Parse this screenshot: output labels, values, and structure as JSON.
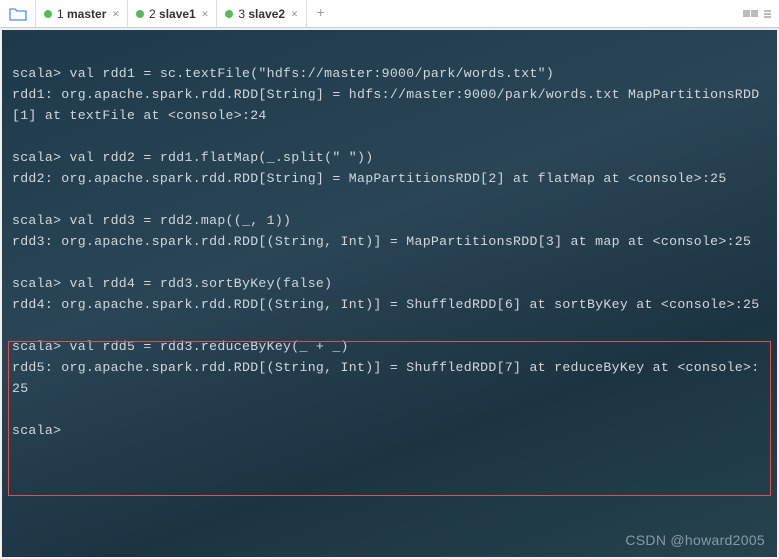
{
  "tabs": [
    {
      "label_prefix": "1 ",
      "label_bold": "master"
    },
    {
      "label_prefix": "2 ",
      "label_bold": "slave1"
    },
    {
      "label_prefix": "3 ",
      "label_bold": "slave2"
    }
  ],
  "console": {
    "lines": [
      "",
      "scala> val rdd1 = sc.textFile(\"hdfs://master:9000/park/words.txt\")",
      "rdd1: org.apache.spark.rdd.RDD[String] = hdfs://master:9000/park/words.txt MapPartitionsRDD[1] at textFile at <console>:24",
      "",
      "scala> val rdd2 = rdd1.flatMap(_.split(\" \"))",
      "rdd2: org.apache.spark.rdd.RDD[String] = MapPartitionsRDD[2] at flatMap at <console>:25",
      "",
      "scala> val rdd3 = rdd2.map((_, 1))",
      "rdd3: org.apache.spark.rdd.RDD[(String, Int)] = MapPartitionsRDD[3] at map at <console>:25",
      "",
      "scala> val rdd4 = rdd3.sortByKey(false)",
      "rdd4: org.apache.spark.rdd.RDD[(String, Int)] = ShuffledRDD[6] at sortByKey at <console>:25",
      "",
      "scala> val rdd5 = rdd3.reduceByKey(_ + _)",
      "rdd5: org.apache.spark.rdd.RDD[(String, Int)] = ShuffledRDD[7] at reduceByKey at <console>:25",
      "",
      "scala>"
    ]
  },
  "watermark": "CSDN @howard2005"
}
